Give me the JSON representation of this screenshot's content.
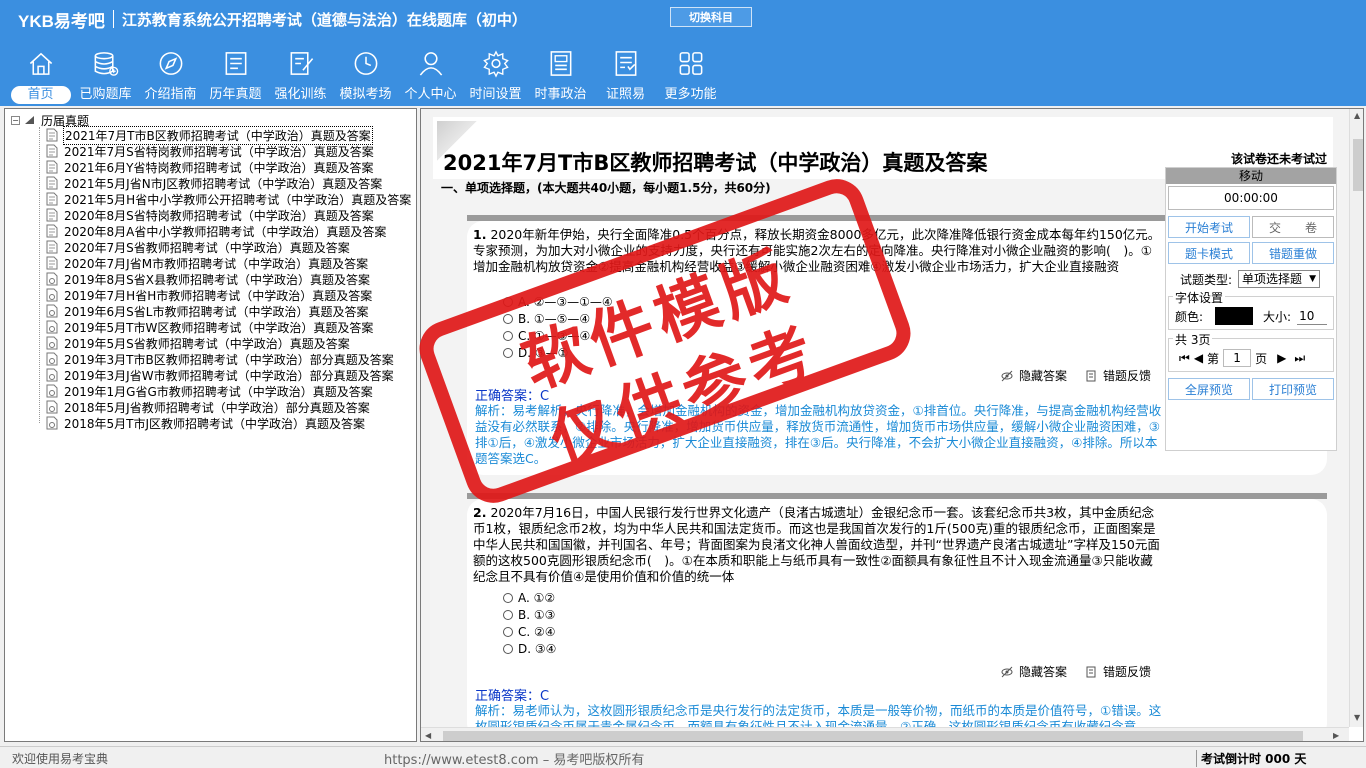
{
  "app": {
    "brand": "YKB易考吧",
    "title": "江苏教育系统公开招聘考试（道德与法治）在线题库（初中）",
    "switch_subject": "切换科目"
  },
  "nav": [
    {
      "label": "首页",
      "icon": "home-icon"
    },
    {
      "label": "已购题库",
      "icon": "database-icon"
    },
    {
      "label": "介绍指南",
      "icon": "compass-icon"
    },
    {
      "label": "历年真题",
      "icon": "document-list-icon"
    },
    {
      "label": "强化训练",
      "icon": "edit-icon"
    },
    {
      "label": "模拟考场",
      "icon": "clock-icon"
    },
    {
      "label": "个人中心",
      "icon": "user-icon"
    },
    {
      "label": "时间设置",
      "icon": "gear-icon"
    },
    {
      "label": "时事政治",
      "icon": "news-icon"
    },
    {
      "label": "证照易",
      "icon": "certificate-icon"
    },
    {
      "label": "更多功能",
      "icon": "grid-icon"
    }
  ],
  "tree": {
    "root": "历届真题",
    "items": [
      "2021年7月T市B区教师招聘考试（中学政治）真题及答案",
      "2021年7月S省特岗教师招聘考试（中学政治）真题及答案",
      "2021年6月Y省特岗教师招聘考试（中学政治）真题及答案",
      "2021年5月J省N市J区教师招聘考试（中学政治）真题及答案",
      "2021年5月H省中小学教师公开招聘考试（中学政治）真题及答案",
      "2020年8月S省特岗教师招聘考试（中学政治）真题及答案",
      "2020年8月A省中小学教师招聘考试（中学政治）真题及答案",
      "2020年7月S省教师招聘考试（中学政治）真题及答案",
      "2020年7月J省M市教师招聘考试（中学政治）真题及答案",
      "2019年8月S省X县教师招聘考试（中学政治）真题及答案",
      "2019年7月H省H市教师招聘考试（中学政治）真题及答案",
      "2019年6月S省L市教师招聘考试（中学政治）真题及答案",
      "2019年5月T市W区教师招聘考试（中学政治）真题及答案",
      "2019年5月S省教师招聘考试（中学政治）真题及答案",
      "2019年3月T市B区教师招聘考试（中学政治）部分真题及答案",
      "2019年3月J省W市教师招聘考试（中学政治）部分真题及答案",
      "2019年1月G省G市教师招聘考试（中学政治）真题及答案",
      "2018年5月J省教师招聘考试（中学政治）部分真题及答案",
      "2018年5月T市J区教师招聘考试（中学政治）真题及答案"
    ]
  },
  "paper": {
    "title": "2021年7月T市B区教师招聘考试（中学政治）真题及答案",
    "status": "该试卷还未考试过",
    "section": "一、单项选择题，(本大题共40小题，每小题1.5分，共60分)"
  },
  "questions": [
    {
      "num": "1.",
      "text": "2020年新年伊始，央行全面降准0.5个百分点，释放长期资金8000多亿元，此次降准降低银行资金成本每年约150亿元。专家预测，为加大对小微企业的支持力度，央行还有可能实施2次左右的定向降准。央行降准对小微企业融资的影响(　)。①增加金融机构放贷资金②提高金融机构经营收益③缓解小微企业融资困难④激发小微企业市场活力，扩大企业直接融资",
      "options": [
        "A. ②—③—①—④",
        "B. ①—⑤—④",
        "C. ①—③—④",
        "D. ③—①"
      ],
      "answer": "正确答案：C",
      "explain": "解析：易考解析，央行降准，会增加金融机构的资金，增加金融机构放贷资金，①排首位。央行降准，与提高金融机构经营收益没有必然联系，②排除。央行降准，增加货币供应量，释放货币流通性，增加货币市场供应量，缓解小微企业融资困难，③排①后，④激发小微企业市场活力，扩大企业直接融资，排在③后。央行降准，不会扩大小微企业直接融资，④排除。所以本题答案选C。"
    },
    {
      "num": "2.",
      "text": "2020年7月16日，中国人民银行发行世界文化遗产（良渚古城遗址）金银纪念币一套。该套纪念币共3枚，其中金质纪念币1枚，银质纪念币2枚，均为中华人民共和国法定货币。而这也是我国首次发行的1斤(500克)重的银质纪念币，正面图案是中华人民共和国国徽，并刊国名、年号；背面图案为良渚文化神人兽面纹造型，并刊“世界遗产良渚古城遗址”字样及150元面额的这枚500克圆形银质纪念币(　)。①在本质和职能上与纸币具有一致性②面额具有象征性且不计入现金流通量③只能收藏纪念且不具有价值④是使用价值和价值的统一体",
      "options": [
        "A. ①②",
        "B. ①③",
        "C. ②④",
        "D. ③④"
      ],
      "answer": "正确答案：C",
      "explain": "解析：易老师认为，这枚圆形银质纪念币是央行发行的法定货币，本质是一般等价物，而纸币的本质是价值符号，①错误。这枚圆形银质纪念币属于贵金属纪念币，而额具有象征性且不计入现金流通量，②正确。这枚圆形银质纪念币有收藏纪念意"
    }
  ],
  "actions": {
    "hide_answer": "隐藏答案",
    "report_error": "错题反馈"
  },
  "side": {
    "move": "移动",
    "timer": "00:00:00",
    "start_exam": "开始考试",
    "submit": "交　　卷",
    "card_mode": "题卡模式",
    "wrong_redo": "错题重做",
    "type_label": "试题类型:",
    "type_value": "单项选择题",
    "font_settings": "字体设置",
    "color_label": "颜色:",
    "size_label": "大小:",
    "size_value": "10",
    "total_pages": "共 3页",
    "page_prefix": "第",
    "page_value": "1",
    "page_suffix": "页",
    "fullscreen": "全屏预览",
    "print": "打印预览"
  },
  "watermark": {
    "line1": "软件模版",
    "line2": "仅供参考"
  },
  "status": {
    "welcome": "欢迎使用易考宝典",
    "site": "https://www.etest8.com – 易考吧版权所有",
    "countdown": "考试倒计时 000 天"
  },
  "colors": {
    "header_blue": "#3b8fe0",
    "answer_blue": "#0a36c8",
    "explain_blue": "#1a8ad6",
    "stamp_red": "#e01818"
  }
}
